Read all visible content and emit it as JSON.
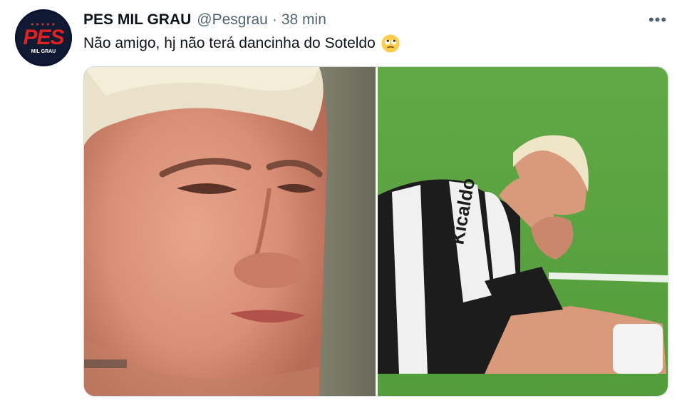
{
  "tweet": {
    "avatar": {
      "logo": "PES",
      "stars": "★★★★★",
      "sub": "MIL GRAU"
    },
    "author_name": "PES MIL GRAU",
    "handle": "@Pesgrau",
    "separator": "·",
    "time": "38 min",
    "text": "Não amigo, hj não terá dancinha do Soteldo",
    "emoji": "face-with-rolling-eyes",
    "more_label": "•••",
    "media": [
      {
        "description": "photo-closeup-crying-player"
      },
      {
        "description": "photo-player-kneeling-on-pitch",
        "shirt_sponsor": "Kicaldo"
      }
    ]
  },
  "colors": {
    "text": "#0f1419",
    "secondary": "#536471",
    "border": "#cfd9de",
    "logo_red": "#e02222"
  }
}
